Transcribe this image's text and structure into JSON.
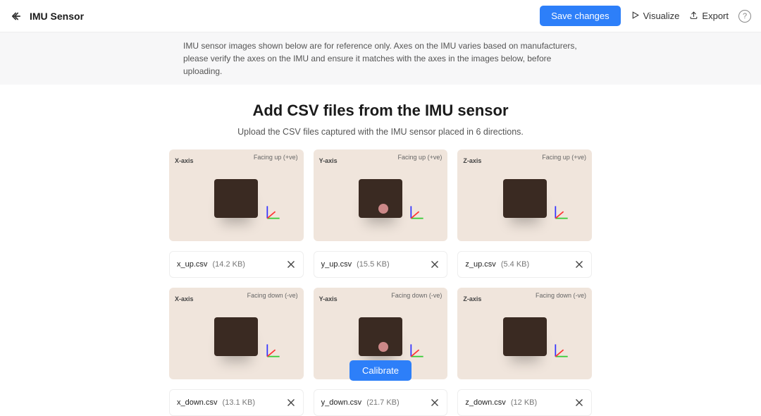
{
  "header": {
    "title": "IMU Sensor",
    "save_label": "Save changes",
    "visualize_label": "Visualize",
    "export_label": "Export"
  },
  "info_text": "IMU sensor images shown below are for reference only. Axes on the IMU varies based on manufacturers, please verify the axes on the IMU and ensure it matches with the axes in the images below, before uploading.",
  "page": {
    "title": "Add CSV files from the IMU sensor",
    "subtitle": "Upload the CSV files captured with the IMU sensor placed in 6 directions."
  },
  "slots": [
    {
      "axis": "X-axis",
      "facing": "Facing up (+ve)",
      "file": "x_up.csv",
      "size": "(14.2 KB)"
    },
    {
      "axis": "Y-axis",
      "facing": "Facing up (+ve)",
      "file": "y_up.csv",
      "size": "(15.5 KB)"
    },
    {
      "axis": "Z-axis",
      "facing": "Facing up (+ve)",
      "file": "z_up.csv",
      "size": "(5.4 KB)"
    },
    {
      "axis": "X-axis",
      "facing": "Facing down (-ve)",
      "file": "x_down.csv",
      "size": "(13.1 KB)"
    },
    {
      "axis": "Y-axis",
      "facing": "Facing down (-ve)",
      "file": "y_down.csv",
      "size": "(21.7 KB)"
    },
    {
      "axis": "Z-axis",
      "facing": "Facing down (-ve)",
      "file": "z_down.csv",
      "size": "(12 KB)"
    }
  ],
  "footer": {
    "calibrate_label": "Calibrate"
  }
}
